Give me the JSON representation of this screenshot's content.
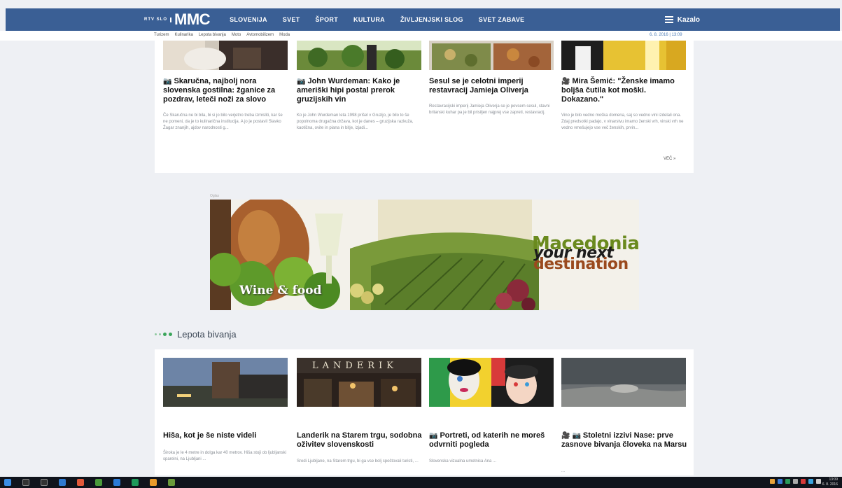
{
  "header": {
    "logo_small": "RTV SLO",
    "logo_big": "MMC",
    "nav": [
      "SLOVENIJA",
      "SVET",
      "ŠPORT",
      "KULTURA",
      "ŽIVLJENJSKI SLOG",
      "SVET ZABAVE"
    ],
    "menu_label": "Kazalo"
  },
  "subbar": {
    "links": [
      "Turizem",
      "Kulinarika",
      "Lepota bivanja",
      "Moto",
      "Avtomobilizem",
      "Moda"
    ],
    "date": "6. 8. 2016 | 13:09"
  },
  "top_cards": [
    {
      "title": "Skaručna, najbolj nora slovenska gostilna: žganice za pozdrav, leteči noži za slovo",
      "desc": "Če Skaručna ne bi bila, bi si jo bilo verjetno treba izmisliti, kar še ne pomeni, da je to kulinarična institucija. A jo je postavil Slavko Žagar znanjih, ajdov narodnosti g..."
    },
    {
      "title": "John Wurdeman: Kako je ameriški hipi postal prerok gruzijskih vin",
      "desc": "Ko je John Wurdeman leta 1998 prišel v Gruzijo, je bilo to še popolnoma drugačna država, kot je danes – gruzijska razkuža, kaotična, ovite in piana in bitje, izjadi..."
    },
    {
      "title": "Sesul se je celotni imperij restavracij Jamieja Oliverja",
      "desc": "Restavracijski imperij Jamieja Oliverja se je povsem sesul, stavni britanski kuhar pa je bil prisiljen najprej vse zapreti, restavracij."
    },
    {
      "title": "Mira Šemić: \"Ženske imamo boljša čutila kot moški. Dokazano.\"",
      "desc": "Vino je bilo vedno moška domena, saj so vedno vini izdelali ona. Zdaj predsotki padajo, v vinarstvu imamo ženski vrh, vinski vrh ne vedno vmešujejo vse več ženskih, prvin..."
    }
  ],
  "more_label": "VEČ »",
  "ad": {
    "label": "Oglas",
    "wine": "Wine & food",
    "line1": "Macedonia",
    "line2": "your next",
    "line3": "destination"
  },
  "section": {
    "title": "Lepota bivanja"
  },
  "bottom_cards": [
    {
      "title": "Hiša, kot je še niste videli",
      "desc": "Široka je le 4 metre in dolga kar 40 metrov. Hiša stoji ob ljubljanski sparelni, na Ljubljani ...",
      "image_text": ""
    },
    {
      "title": "Landerik na Starem trgu, sodobna oživitev slovenskosti",
      "desc": "Sredi Ljubljane, na Starem trgu, bi ga vse bolj spoštovali turisti, ...",
      "image_text": "LANDERIK"
    },
    {
      "title": "Portreti, od katerih ne moreš odvrniti pogleda",
      "desc": "Slovenska vizualna umetnica Ana ...",
      "image_text": ""
    },
    {
      "title": "Stoletni izzivi Nase: prve zasnove bivanja človeka na Marsu",
      "desc": "...",
      "image_text": ""
    }
  ],
  "taskbar": {
    "clock_time": "13:09",
    "clock_date": "6. 8. 2016"
  },
  "colors": {
    "nav_bg": "#3a5f95",
    "accent_green": "#3aa55a",
    "page_bg": "#eef0f4"
  }
}
